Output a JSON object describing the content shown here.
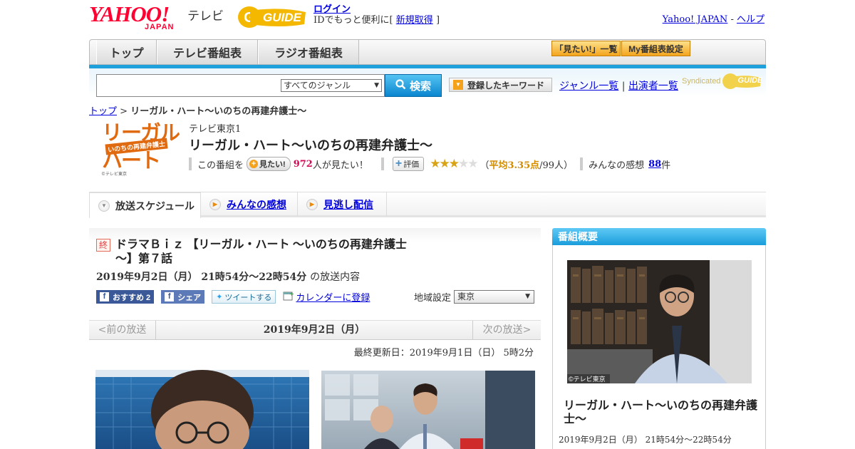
{
  "header": {
    "yahoo_text": "YAHOO!",
    "japan_text": "JAPAN",
    "tv_word": "テレビ",
    "gguide_text": "GUIDE",
    "login_link": "ログイン",
    "login_sub": "IDでもっと便利に[",
    "signup_link": "新規取得",
    "login_sub_end": "]",
    "yahoo_japan_link": "Yahoo! JAPAN",
    "help_sep": "-",
    "help_link": "ヘルプ"
  },
  "nav": {
    "tabs": [
      "トップ",
      "テレビ番組表",
      "ラジオ番組表"
    ],
    "mitai_list": "「見たい!」一覧",
    "my_program": "My番組表設定"
  },
  "search": {
    "placeholder": "",
    "genre_selected": "すべてのジャンル",
    "search_button": "検索",
    "keyword_button": "登録したキーワード",
    "genre_list_link": "ジャンル一覧",
    "divider": "|",
    "cast_list_link": "出演者一覧",
    "syndicated": "Syndicated",
    "syndicated_logo": "GUIDE"
  },
  "breadcrumb": {
    "top": "トップ",
    "sep": ">",
    "current": "リーガル・ハート～いのちの再建弁護士～"
  },
  "program": {
    "logo_line1": "リーガル",
    "logo_line2": "いのちの再建弁護士",
    "logo_line3": "ハート",
    "logo_credit": "©テレビ東京",
    "station": "テレビ東京1",
    "title": "リーガル・ハート～いのちの再建弁護士～",
    "want_prefix": "この番組を",
    "want_button": "見たい!",
    "want_count": "972",
    "want_suffix": "人が見たい！",
    "rating_button": "評価",
    "rating_value": 3.35,
    "rating_text_open": "（",
    "rating_avg": "平均3.35点",
    "rating_count": "/99人）",
    "impressions_prefix": "みんなの感想",
    "impressions_count": "88",
    "impressions_suffix": "件"
  },
  "program_tabs": {
    "schedule": "放送スケジュール",
    "impressions": "みんなの感想",
    "vod": "見逃し配信"
  },
  "episode": {
    "end_mark": "終",
    "title": "ドラマＢｉｚ 【リーガル・ハート ～いのちの再建弁護士～】第７話",
    "date_time": "2019年9月2日（月） 21時54分～22時54分",
    "date_suffix": "の放送内容",
    "fb_recommend": "おすすめ 2",
    "fb_share": "シェア",
    "tweet": "ツイートする",
    "calendar": "カレンダーに登録",
    "region_label": "地域設定",
    "region_value": "東京"
  },
  "date_nav": {
    "prev": "<前の放送",
    "current": "2019年9月2日（月）",
    "next": "次の放送>"
  },
  "updated": "最終更新日：2019年9月1日（日） 5時2分",
  "sidebar": {
    "heading": "番組概要",
    "photo_credit": "©テレビ東京",
    "title": "リーガル・ハート～いのちの再建弁護士～",
    "date": "2019年9月2日（月） 21時54分～22時54分"
  },
  "colors": {
    "accent_blue": "#1ea0dc",
    "yahoo_red": "#ff0033",
    "star_gold": "#d8a315",
    "count_pink": "#d40b56"
  }
}
